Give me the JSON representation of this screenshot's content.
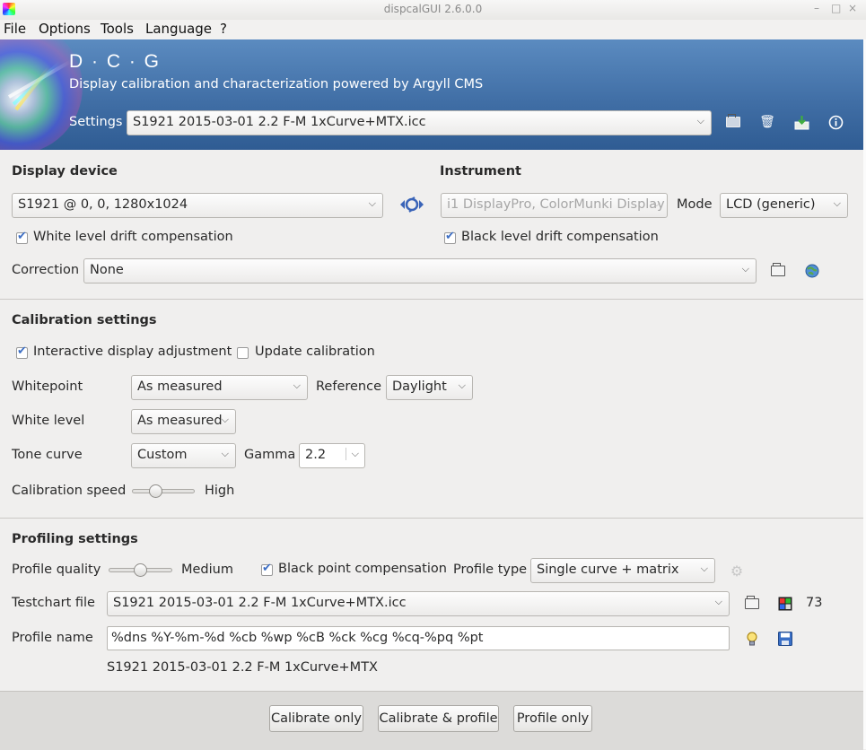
{
  "window": {
    "title": "dispcalGUI 2.6.0.0",
    "controls": [
      "–",
      "□",
      "×"
    ]
  },
  "menu": [
    "File",
    "Options",
    "Tools",
    "Language",
    "?"
  ],
  "banner": {
    "logo": "D · C · G",
    "subtitle": "Display calibration and characterization powered by Argyll CMS",
    "settings_label": "Settings",
    "settings_value": "S1921 2015-03-01 2.2 F-M 1xCurve+MTX.icc",
    "icons": [
      "folder-icon",
      "delete-icon",
      "install-icon",
      "info-icon"
    ]
  },
  "display": {
    "title": "Display device",
    "device": "S1921 @ 0, 0, 1280x1024",
    "white_drift": "White level drift compensation",
    "correction_label": "Correction",
    "correction_value": "None"
  },
  "instrument": {
    "title": "Instrument",
    "value": "i1 DisplayPro, ColorMunki Display",
    "mode_label": "Mode",
    "mode_value": "LCD (generic)",
    "black_drift": "Black level drift compensation"
  },
  "calibration": {
    "title": "Calibration settings",
    "interactive": "Interactive display adjustment",
    "update": "Update calibration",
    "whitepoint_label": "Whitepoint",
    "whitepoint_value": "As measured",
    "reference_label": "Reference",
    "reference_value": "Daylight",
    "white_level_label": "White level",
    "white_level_value": "As measured",
    "tone_curve_label": "Tone curve",
    "tone_curve_value": "Custom",
    "gamma_label": "Gamma",
    "gamma_value": "2.2",
    "speed_label": "Calibration speed",
    "speed_value": "High",
    "speed_level": 0.35
  },
  "profiling": {
    "title": "Profiling settings",
    "quality_label": "Profile quality",
    "quality_value": "Medium",
    "quality_level": 0.5,
    "bpc": "Black point compensation",
    "type_label": "Profile type",
    "type_value": "Single curve + matrix",
    "testchart_label": "Testchart file",
    "testchart_value": "S1921 2015-03-01 2.2 F-M 1xCurve+MTX.icc",
    "patch_count": "73",
    "name_label": "Profile name",
    "name_value": "%dns %Y-%m-%d %cb %wp %cB %ck %cg %cq-%pq %pt",
    "name_preview": "S1921 2015-03-01 2.2 F-M 1xCurve+MTX"
  },
  "buttons": {
    "calibrate": "Calibrate only",
    "calibrate_profile": "Calibrate & profile",
    "profile": "Profile only"
  },
  "colors": {
    "banner": "#416fa6",
    "check": "#3e6fc4"
  }
}
